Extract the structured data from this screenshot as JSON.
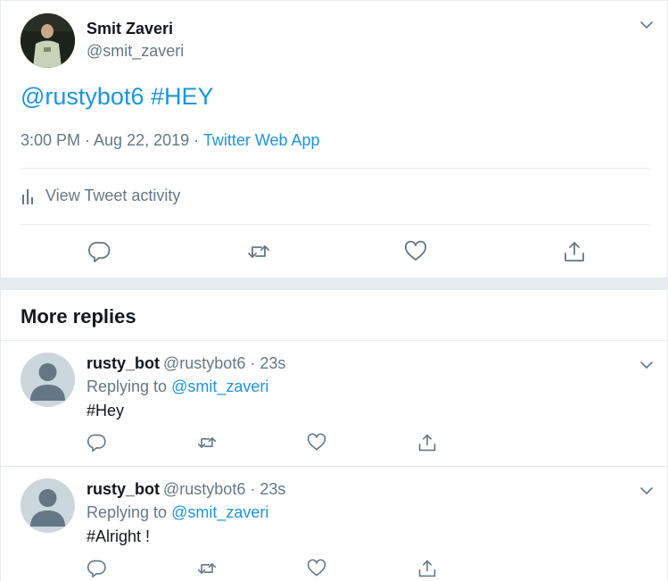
{
  "main_tweet": {
    "author_name": "Smit Zaveri",
    "author_handle": "@smit_zaveri",
    "text_parts": [
      "@rustybot6",
      "#HEY"
    ],
    "time": "3:00 PM · Aug 22, 2019 · ",
    "source": "Twitter Web App",
    "activity_label": "View Tweet activity",
    "actions": [
      "reply-icon",
      "retweet-icon",
      "like-icon",
      "share-icon"
    ]
  },
  "section_title": "More replies",
  "replies": [
    {
      "name": "rusty_bot",
      "handle_time": "@rustybot6 · 23s",
      "replying_prefix": "Replying to",
      "replying_to": "@smit_zaveri",
      "text": "#Hey"
    },
    {
      "name": "rusty_bot",
      "handle_time": "@rustybot6 · 23s",
      "replying_prefix": "Replying to",
      "replying_to": "@smit_zaveri",
      "text": "#Alright !"
    }
  ],
  "colors": {
    "link": "#1b95e0",
    "muted": "#657786",
    "text": "#14171a",
    "border": "#e6ecf0",
    "default_avatar": "#ccd6dd"
  }
}
